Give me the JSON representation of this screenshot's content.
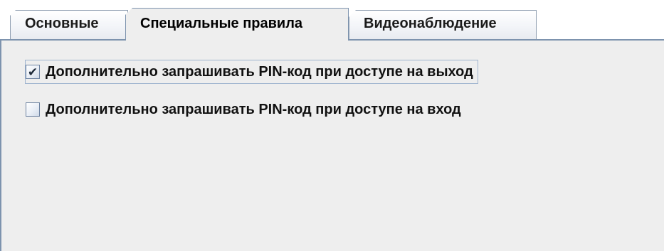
{
  "tabs": [
    {
      "label": "Основные",
      "selected": false
    },
    {
      "label": "Специальные правила",
      "selected": true
    },
    {
      "label": "Видеонаблюдение",
      "selected": false
    }
  ],
  "options": [
    {
      "label": "Дополнительно запрашивать PIN-код при доступе на выход",
      "checked": true,
      "check_glyph": "✔"
    },
    {
      "label": "Дополнительно запрашивать PIN-код при доступе на вход",
      "checked": false,
      "check_glyph": ""
    }
  ],
  "colors": {
    "panel_background": "#eeeeee",
    "tab_border": "#7d93ae",
    "focus_outline": "#9fb4cf"
  }
}
